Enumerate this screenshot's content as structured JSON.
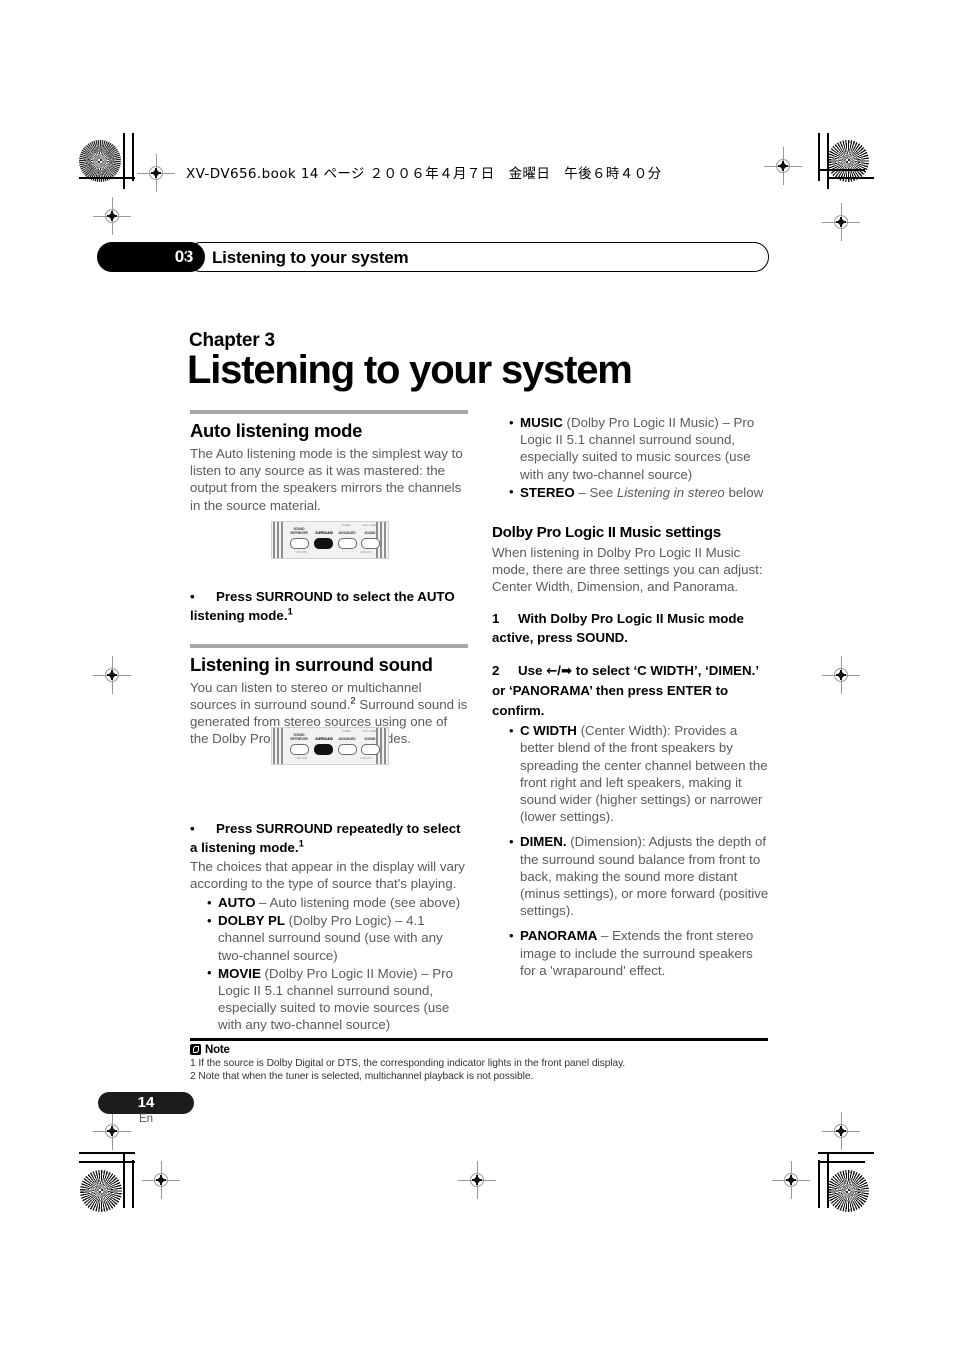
{
  "header": {
    "book_info": "XV-DV656.book  14 ページ  ２００６年４月７日　金曜日　午後６時４０分",
    "running_number": "03",
    "running_title": "Listening to your system"
  },
  "chapter": {
    "label": "Chapter 3",
    "title": "Listening to your system"
  },
  "left_column": {
    "section1": {
      "heading": "Auto listening mode",
      "paragraph": "The Auto listening mode is the simplest way to listen to any source as it was mastered: the output from the speakers mirrors the channels in the source material.",
      "instruction_mark": "•",
      "instruction_text": "Press SURROUND to select the AUTO listening mode.",
      "instruction_footnote": "1"
    },
    "section2": {
      "heading": "Listening in surround sound",
      "paragraph_a": "You can listen to stereo or multichannel sources in surround sound.",
      "paragraph_a_footnote": "2",
      "paragraph_b": " Surround sound is generated from stereo sources using one of the Dolby Pro Logic decoding modes.",
      "instruction_mark": "•",
      "instruction_text": "Press SURROUND repeatedly to select a listening mode.",
      "instruction_footnote": "1",
      "paragraph_after": "The choices that appear in the display will vary according to the type of source that's playing.",
      "options": [
        {
          "term": "AUTO",
          "rest": " – Auto listening mode (see above)"
        },
        {
          "term": "DOLBY PL",
          "rest": " (Dolby Pro Logic) – 4.1 channel surround sound (use with any two-channel source)"
        },
        {
          "term": "MOVIE",
          "rest": " (Dolby Pro Logic II Movie) – Pro Logic II 5.1 channel surround sound, especially suited to movie sources (use with any two-channel source)"
        }
      ]
    }
  },
  "right_column": {
    "options_continued": [
      {
        "term": "MUSIC",
        "rest": " (Dolby Pro Logic II Music) – Pro Logic II 5.1 channel surround sound, especially suited to music sources (use with any two-channel source)"
      },
      {
        "term": "STEREO",
        "pre": " – See ",
        "italic": "Listening in stereo",
        "post": " below"
      }
    ],
    "section3": {
      "heading": "Dolby Pro Logic II Music settings",
      "paragraph": "When listening in Dolby Pro Logic II Music mode, there are three settings you can adjust: Center Width, Dimension, and Panorama.",
      "step1_mark": "1",
      "step1_text": "With Dolby Pro Logic II Music mode active, press SOUND.",
      "step2_mark": "2",
      "step2_text_a": "Use ",
      "step2_arrow_left": "←",
      "step2_slash": "/",
      "step2_arrow_right": "➡",
      "step2_text_b": " to select ‘C WIDTH’, ‘DIMEN.’ or ‘PANORAMA’ then press ENTER to confirm.",
      "settings": [
        {
          "term": "C WIDTH",
          "rest": " (Center Width): Provides a better blend of the front speakers by spreading the center channel between the front right and left speakers, making it sound wider (higher settings) or narrower (lower settings)."
        },
        {
          "term": "DIMEN.",
          "rest": " (Dimension): Adjusts the depth of the surround sound balance from front to back, making the sound more distant (minus settings), or more forward (positive settings)."
        },
        {
          "term": "PANORAMA",
          "rest": " – Extends the front stereo image to include the surround speakers for a 'wraparound' effect."
        }
      ]
    }
  },
  "illustrations": {
    "panel1": {
      "top_labels": [
        "",
        "",
        "TUNER",
        "AUX / GAME"
      ],
      "button_labels": [
        "SOUND\nRETRIEVER",
        "SURROUND",
        "ADVANCED",
        "SOUND"
      ],
      "bottom_labels": [
        "",
        "MIC VOL",
        "",
        "CAN VOL"
      ],
      "active_button": "SURROUND"
    },
    "panel2": {
      "top_labels": [
        "",
        "",
        "TUNER",
        "AUX / GAME"
      ],
      "button_labels": [
        "SOUND\nRETRIEVER",
        "SURROUND",
        "ADVANCED",
        "SOUND"
      ],
      "bottom_labels": [
        "",
        "MIC VOL",
        "",
        "CAN VOL"
      ],
      "active_button": "SURROUND"
    }
  },
  "notes": {
    "title": "Note",
    "lines": [
      "1 If the source is Dolby Digital or DTS, the corresponding indicator lights in the front panel display.",
      "2 Note that when the tuner is selected, multichannel playback is not possible."
    ]
  },
  "footer": {
    "page_number": "14",
    "language": "En"
  }
}
